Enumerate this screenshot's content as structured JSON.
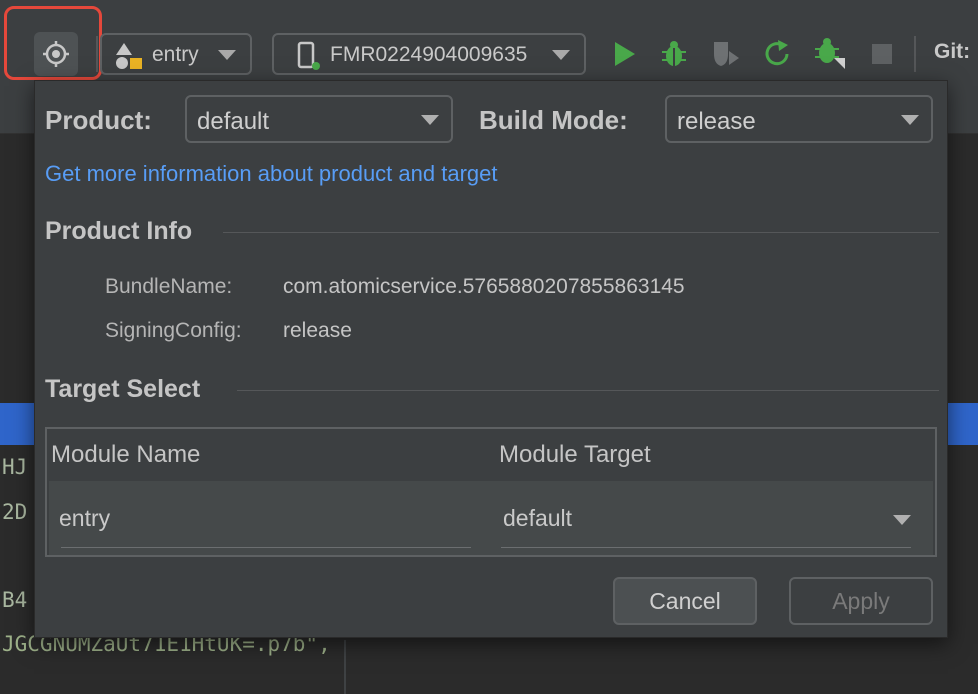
{
  "toolbar": {
    "module_label": "entry",
    "device_label": "FMR0224904009635",
    "git_label": "Git:"
  },
  "editor": {
    "fragment_1": "HJ",
    "fragment_2": "2D",
    "fragment_3": "B4",
    "long_line": "JGCGNUMZaUt71E1HtUK=.p7b\","
  },
  "popup": {
    "product_label": "Product:",
    "product_value": "default",
    "build_mode_label": "Build Mode:",
    "build_mode_value": "release",
    "info_link": "Get more information about product and target",
    "product_info": {
      "title": "Product Info",
      "bundle_key": "BundleName:",
      "bundle_value": "com.atomicservice.5765880207855863145",
      "signing_key": "SigningConfig:",
      "signing_value": "release"
    },
    "target_select": {
      "title": "Target Select",
      "columns": [
        "Module Name",
        "Module Target"
      ],
      "rows": [
        {
          "module_name": "entry",
          "module_target": "default"
        }
      ]
    },
    "cancel_label": "Cancel",
    "apply_label": "Apply"
  },
  "colors": {
    "highlight": "#e5483b",
    "link": "#589df6",
    "run_green": "#49a84a",
    "selection_blue": "#2f65ca"
  },
  "icons": [
    "settings-icon",
    "module-icon",
    "phone-icon",
    "run-icon",
    "debug-icon",
    "profiler-icon",
    "restart-icon",
    "attach-debugger-icon",
    "stop-icon"
  ]
}
